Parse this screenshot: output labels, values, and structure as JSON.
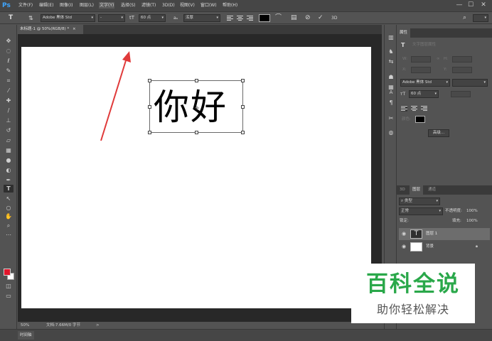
{
  "app": {
    "logo": "Ps"
  },
  "menu": {
    "items": [
      "文件(F)",
      "编辑(E)",
      "图像(I)",
      "图层(L)",
      "文字(Y)",
      "选择(S)",
      "滤镜(T)",
      "3D(D)",
      "视图(V)",
      "窗口(W)",
      "帮助(H)"
    ],
    "active_index": 4
  },
  "window_controls": {
    "minimize": "—",
    "maximize": "☐",
    "close": "✕"
  },
  "options_bar": {
    "font_family": "Adobe 黑体 Std",
    "font_style": "-",
    "font_size": "60 点",
    "anti_alias_label": "aₐ",
    "anti_alias": "浑厚",
    "text_color": "#000000",
    "size_icon": "tT",
    "warp_icon": "warp-text-icon",
    "panel_icon": "character-panel-icon",
    "cancel_icon": "cancel-icon",
    "commit_icon": "commit-icon",
    "3d_label": "3D"
  },
  "document": {
    "tab_label": "未标题-1 @ 50%(RGB/8) *",
    "tab_close": "×",
    "canvas_text": "你好",
    "zoom": "50%",
    "doc_info": "文档:7.66M/0 字节",
    "status_arrow": ">"
  },
  "tools": {
    "items": [
      "move-icon",
      "marquee-icon",
      "lasso-icon",
      "quick-select-icon",
      "crop-icon",
      "eyedropper-icon",
      "healing-icon",
      "brush-icon",
      "stamp-icon",
      "history-brush-icon",
      "eraser-icon",
      "gradient-icon",
      "blur-icon",
      "dodge-icon",
      "pen-icon",
      "type-icon",
      "path-select-icon",
      "shape-icon",
      "hand-icon",
      "zoom-icon",
      "more-icon"
    ],
    "active": "type-icon",
    "foreground_color": "#e0162b",
    "background_color": "#ffffff"
  },
  "properties_panel": {
    "tab": "属性",
    "subtitle": "文字图层属性",
    "w_label": "W:",
    "h_label": "H:",
    "x_label": "X:",
    "y_label": "Y:",
    "font_family": "Adobe 黑体 Std",
    "font_size": "60 点",
    "color_label": "颜色:",
    "color": "#000000",
    "more_button": "高级..."
  },
  "layers_panel": {
    "tabs": [
      "3D",
      "图层",
      "通道"
    ],
    "active_tab": "图层",
    "search_placeholder": "类型",
    "blend_mode": "正常",
    "opacity_label": "不透明度:",
    "opacity": "100%",
    "lock_label": "锁定:",
    "fill_label": "填充:",
    "fill": "100%",
    "layers": [
      {
        "name": "图层 1",
        "type": "text",
        "selected": true
      },
      {
        "name": "背景",
        "type": "background",
        "selected": false
      }
    ]
  },
  "timeline": {
    "tab": "时间轴"
  },
  "watermark": {
    "title": "百科全说",
    "subtitle": "助你轻松解决"
  },
  "colors": {
    "ui_bg": "#535353",
    "canvas_bg": "#282828",
    "watermark_green": "#2aa84a",
    "arrow_red": "#e03a3a"
  }
}
